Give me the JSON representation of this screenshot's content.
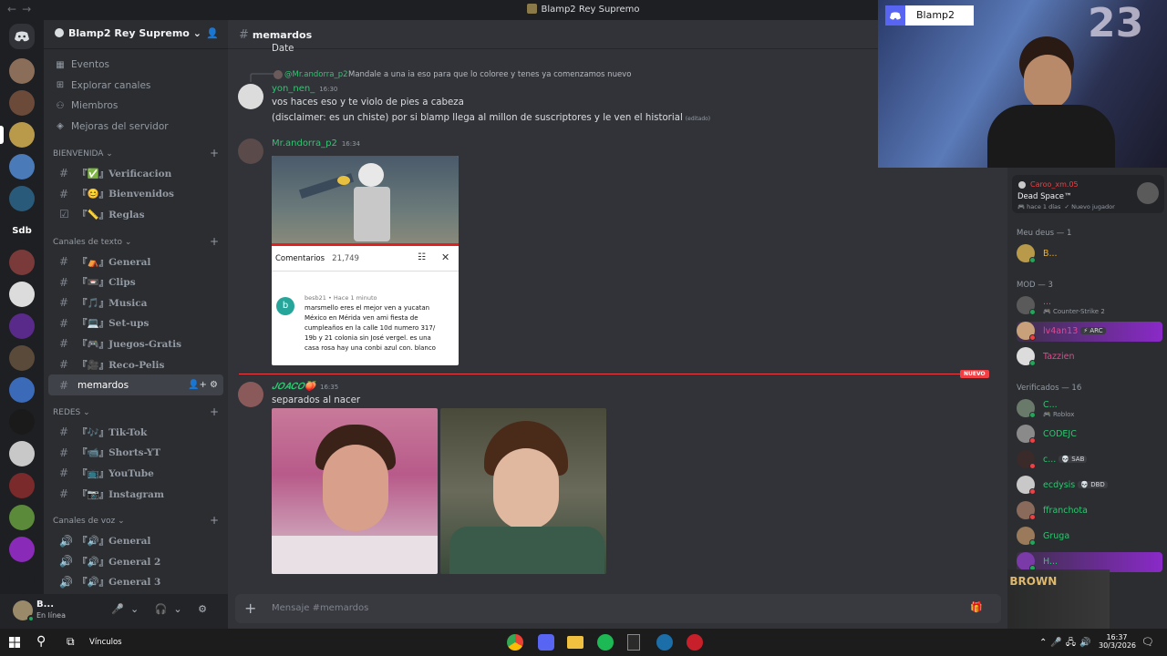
{
  "window": {
    "title": "Blamp2 Rey Supremo",
    "back": "←",
    "forward": "→"
  },
  "servers": [
    {
      "label": "",
      "color": "#8b6e5a"
    },
    {
      "label": "",
      "color": "#6b4a3a"
    },
    {
      "label": "",
      "color": "#b89a4a",
      "active": true
    },
    {
      "label": "",
      "color": "#4a7ab8"
    },
    {
      "label": "",
      "color": "#2a5a7a"
    },
    {
      "label": "Sdb",
      "color": "#1e1f22"
    },
    {
      "label": "",
      "color": "#7a3a3a"
    },
    {
      "label": "",
      "color": "#dcdcdc"
    },
    {
      "label": "",
      "color": "#5a2a8a"
    },
    {
      "label": "",
      "color": "#5a4a3a"
    },
    {
      "label": "",
      "color": "#3a6ab8"
    },
    {
      "label": "",
      "color": "#1a1a1a"
    },
    {
      "label": "",
      "color": "#c8c8c8"
    },
    {
      "label": "",
      "color": "#7a2a2a"
    },
    {
      "label": "",
      "color": "#5a8a3a"
    },
    {
      "label": "",
      "color": "#8a2ab8"
    },
    {
      "label": "",
      "color": "#1e1f22"
    },
    {
      "label": "",
      "color": "#c83a3a"
    }
  ],
  "guild": {
    "name": "Blamp2 Rey Supremo",
    "chevron": "⌄"
  },
  "nav": [
    {
      "icon": "▦",
      "label": "Eventos"
    },
    {
      "icon": "⊞",
      "label": "Explorar canales"
    },
    {
      "icon": "⚇",
      "label": "Miembros"
    },
    {
      "icon": "◈",
      "label": "Mejoras del servidor"
    }
  ],
  "categories": {
    "bienvenida": {
      "name": "BIENVENIDA ⌄",
      "channels": [
        {
          "icon": "#",
          "label": "『✅』Verificacion"
        },
        {
          "icon": "#",
          "label": "『😊』Bienvenidos"
        },
        {
          "icon": "☑",
          "label": "『📏』Reglas"
        }
      ]
    },
    "texto": {
      "name": "Canales de texto ⌄",
      "channels": [
        {
          "icon": "#",
          "label": "『⛺』General"
        },
        {
          "icon": "#",
          "label": "『📼』Clips"
        },
        {
          "icon": "#",
          "label": "『🎵』Musica"
        },
        {
          "icon": "#",
          "label": "『💻』Set-ups"
        },
        {
          "icon": "#",
          "label": "『🎮』Juegos-Gratis"
        },
        {
          "icon": "#",
          "label": "『🎥』Reco-Pelis"
        }
      ],
      "active": {
        "icon": "#",
        "label": "memardos",
        "actions": "👤+ ⚙"
      }
    },
    "redes": {
      "name": "REDES ⌄",
      "channels": [
        {
          "icon": "#",
          "label": "『🎶』Tik-Tok"
        },
        {
          "icon": "#",
          "label": "『📹』Shorts-YT"
        },
        {
          "icon": "#",
          "label": "『📺』YouTube"
        },
        {
          "icon": "#",
          "label": "『📷』Instagram"
        }
      ]
    },
    "voz": {
      "name": "Canales de voz ⌄",
      "channels": [
        {
          "icon": "🔊",
          "label": "『🔊』General"
        },
        {
          "icon": "🔊",
          "label": "『🔊』General 2"
        },
        {
          "icon": "🔊",
          "label": "『🔊』General 3"
        }
      ]
    }
  },
  "user": {
    "name": "B...",
    "status": "En línea",
    "controls": "🎤⌄ 🎧⌄ ⚙"
  },
  "chat": {
    "channel": "memardos",
    "top_fragment": "Date",
    "reply": {
      "author": "@Mr.andorra_p2",
      "text": "Mandale a una ia eso para que lo coloree y tenes ya comenzamos nuevo"
    },
    "messages": [
      {
        "author": "yon_nen_",
        "color": "#2dc770",
        "time": "16:30",
        "lines": [
          "vos haces eso y te violo de pies a cabeza",
          "(disclaimer: es un chiste) por si blamp llega al millon de suscriptores y le ven el historial"
        ],
        "edited": "(editado)"
      },
      {
        "author": "Mr.andorra_p2",
        "color": "#2dc770",
        "time": "16:34"
      },
      {
        "author": "𝑱𝑶𝑨𝑪𝑶🍑",
        "color": "#2dc770",
        "time": "16:35",
        "lines": [
          "separados al nacer"
        ]
      }
    ],
    "screenshot": {
      "comments_label": "Comentarios",
      "comments_count": "21,749",
      "commenter": "besb21 • Hace 1 minuto",
      "avatar_letter": "b",
      "comment_lines": [
        "marsmello eres el mejor ven a yucatan",
        "México  en Mérida ven ami fiesta de",
        "cumpleaños  en la calle 10d numero 317/",
        "19b y 21 colonia sin José vergel. es una",
        "casa rosa  hay una conbi azul  con. blanco"
      ]
    },
    "new_badge": "NUEVO",
    "composer_placeholder": "Mensaje #memardos"
  },
  "activity": {
    "user": "Caroo_xm.05",
    "game": "Dead Space™",
    "meta": "hace 1 días",
    "badge": "Nuevo jugador"
  },
  "members": {
    "groups": [
      {
        "title": "Meu deus — 1",
        "members": [
          {
            "name": "B...",
            "color": "#f0b232",
            "avatar": "#b89a4a",
            "dot": "#23a55a"
          }
        ]
      },
      {
        "title": "MOD — 3",
        "members": [
          {
            "name": "...",
            "color": "#e8458f",
            "status": "🎮 Counter-Strike 2",
            "avatar": "#5a5a5a",
            "dot": "#23a55a"
          },
          {
            "name": "lv4an13",
            "color": "#e8458f",
            "tag": "⚡ ARC",
            "avatar": "#c8a07a",
            "dot": "#f23f43",
            "highlight": true
          },
          {
            "name": "Tazzien",
            "color": "#e8458f",
            "avatar": "#dcdcdc",
            "dot": "#23a55a"
          }
        ]
      },
      {
        "title": "Verificados — 16",
        "members": [
          {
            "name": "C...",
            "color": "#2dc770",
            "status": "🎮 Roblox",
            "avatar": "#6a7a6a",
            "dot": "#23a55a"
          },
          {
            "name": "CODEJC",
            "color": "#2dc770",
            "avatar": "#8a8a8a",
            "dot": "#f23f43"
          },
          {
            "name": "c...",
            "color": "#2dc770",
            "tag": "💀 SAB",
            "avatar": "#3a2a2a",
            "dot": "#f23f43"
          },
          {
            "name": "ecdysis",
            "color": "#2dc770",
            "tag": "💀 DBD",
            "avatar": "#c8c8c8",
            "dot": "#f23f43"
          },
          {
            "name": "ffranchota",
            "color": "#2dc770",
            "avatar": "#8a6a5a",
            "dot": "#f23f43"
          },
          {
            "name": "Gruga",
            "color": "#2dc770",
            "avatar": "#9a7a5a",
            "dot": "#23a55a"
          },
          {
            "name": "H...",
            "color": "#2dc770",
            "avatar": "#7a3aa8",
            "dot": "#23a55a",
            "highlight": true
          }
        ]
      }
    ]
  },
  "stream": {
    "name": "Blamp2",
    "digits": "23",
    "now_playing": "CHRIS BROWN"
  },
  "taskbar": {
    "search_label": "Vínculos",
    "time": "16:37",
    "date": "30/3/2026"
  }
}
